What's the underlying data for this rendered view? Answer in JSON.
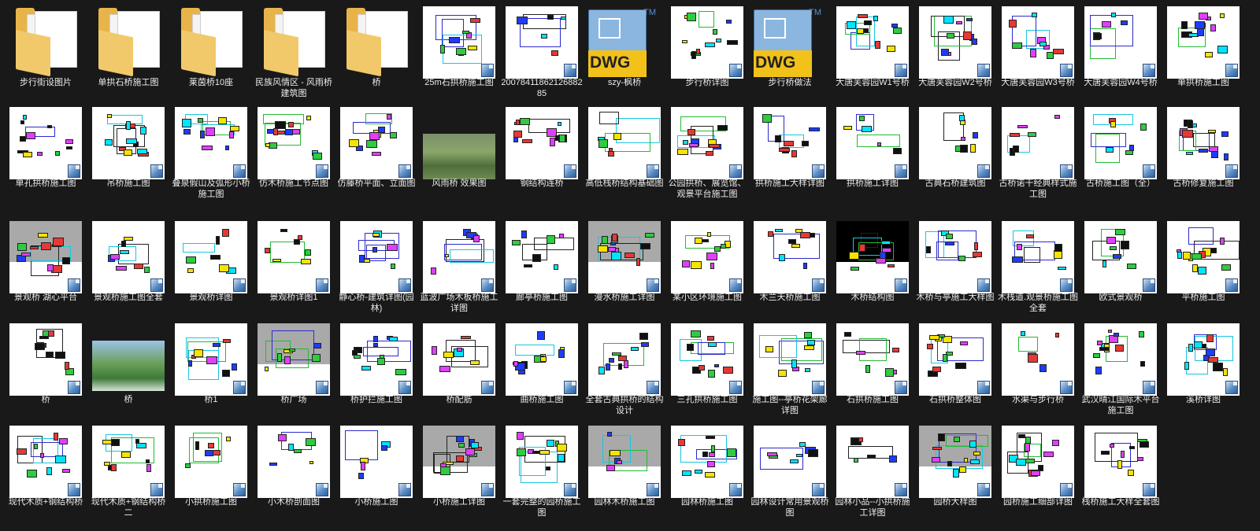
{
  "items": [
    {
      "label": "步行街设图片",
      "kind": "folder"
    },
    {
      "label": "单拱石桥施工图",
      "kind": "folder"
    },
    {
      "label": "莱茵桥10座",
      "kind": "folder"
    },
    {
      "label": "民族风情区 - 风雨桥建筑图",
      "kind": "folder"
    },
    {
      "label": "桥",
      "kind": "folder"
    },
    {
      "label": "25m石拱桥施工图",
      "kind": "cad"
    },
    {
      "label": "2007841186212688285",
      "kind": "cad"
    },
    {
      "label": "szy-枫桥",
      "kind": "dwg"
    },
    {
      "label": "步行桥详图",
      "kind": "cad"
    },
    {
      "label": "步行桥做法",
      "kind": "dwg"
    },
    {
      "label": "大唐芙蓉园W1号桥",
      "kind": "cad"
    },
    {
      "label": "大唐芙蓉园W2号桥",
      "kind": "cad"
    },
    {
      "label": "大唐芙蓉园W3号桥",
      "kind": "cad"
    },
    {
      "label": "大唐芙蓉园W4号桥",
      "kind": "cad"
    },
    {
      "label": "单拱桥施工图",
      "kind": "cad"
    },
    {
      "label": "单孔拱桥施工图",
      "kind": "cad"
    },
    {
      "label": "吊桥施工图",
      "kind": "cad"
    },
    {
      "label": "叠泉假山及弧形小桥施工图",
      "kind": "cad"
    },
    {
      "label": "仿木桥施工节点图",
      "kind": "cad"
    },
    {
      "label": "仿藤桥平面、立面图",
      "kind": "cad"
    },
    {
      "label": "风雨桥 效果图",
      "kind": "photo"
    },
    {
      "label": "钢结构连桥",
      "kind": "cad"
    },
    {
      "label": "高低栈桥结构基础图",
      "kind": "cad"
    },
    {
      "label": "公园拱桥、展览馆、观景平台施工图",
      "kind": "cad"
    },
    {
      "label": "拱桥施工大样详图",
      "kind": "cad"
    },
    {
      "label": "拱桥施工详图",
      "kind": "cad"
    },
    {
      "label": "古典石桥建筑图",
      "kind": "cad"
    },
    {
      "label": "古桥诺干经典样式施工图",
      "kind": "cad"
    },
    {
      "label": "古桥施工图（全）",
      "kind": "cad"
    },
    {
      "label": "古桥修复施工图",
      "kind": "cad"
    },
    {
      "label": "景观桥 湖心平台",
      "kind": "cad"
    },
    {
      "label": "景观桥施工图全套",
      "kind": "cad"
    },
    {
      "label": "景观桥详图",
      "kind": "cad"
    },
    {
      "label": "景观桥详图1",
      "kind": "cad"
    },
    {
      "label": "静心桥-建筑详图(园林)",
      "kind": "cad"
    },
    {
      "label": "蓝波广场木板桥施工详图",
      "kind": "cad"
    },
    {
      "label": "廊亭桥施工图",
      "kind": "cad"
    },
    {
      "label": "漫水桥施工详图",
      "kind": "cad"
    },
    {
      "label": "某小区环境施工图",
      "kind": "cad"
    },
    {
      "label": "木兰天桥施工图",
      "kind": "cad"
    },
    {
      "label": "木桥结构图",
      "kind": "cad"
    },
    {
      "label": "木桥与亭施工大样图",
      "kind": "cad"
    },
    {
      "label": "木栈道.观景桥施工图全套",
      "kind": "cad"
    },
    {
      "label": "欧式景观桥",
      "kind": "cad"
    },
    {
      "label": "平桥施工图",
      "kind": "cad"
    },
    {
      "label": "桥",
      "kind": "cad"
    },
    {
      "label": "桥",
      "kind": "photo"
    },
    {
      "label": "桥1",
      "kind": "cad"
    },
    {
      "label": "桥广场",
      "kind": "cad"
    },
    {
      "label": "桥护拦施工图",
      "kind": "cad"
    },
    {
      "label": "桥配筋",
      "kind": "cad"
    },
    {
      "label": "曲桥施工图",
      "kind": "cad"
    },
    {
      "label": "全套古典拱桥的结构设计",
      "kind": "cad"
    },
    {
      "label": "三孔拱桥施工图",
      "kind": "cad"
    },
    {
      "label": "施工图--亭桥花架廊详图",
      "kind": "cad"
    },
    {
      "label": "石拱桥施工图",
      "kind": "cad"
    },
    {
      "label": "石拱桥整体图",
      "kind": "cad"
    },
    {
      "label": "水渠与步行桥",
      "kind": "cad"
    },
    {
      "label": "武汉晴江国际木平台施工图",
      "kind": "cad"
    },
    {
      "label": "溪桥详图",
      "kind": "cad"
    },
    {
      "label": "现代木质+钢结构桥",
      "kind": "cad"
    },
    {
      "label": "现代木质+钢结构桥二",
      "kind": "cad"
    },
    {
      "label": "小拱桥施工图",
      "kind": "cad"
    },
    {
      "label": "小木桥剖面图",
      "kind": "cad"
    },
    {
      "label": "小桥施工图",
      "kind": "cad"
    },
    {
      "label": "小桥施工详图",
      "kind": "cad"
    },
    {
      "label": "一套完整的园桥施工图",
      "kind": "cad"
    },
    {
      "label": "园林木桥施工图",
      "kind": "cad"
    },
    {
      "label": "园林桥施工图",
      "kind": "cad"
    },
    {
      "label": "园林设计常用景观桥图",
      "kind": "cad"
    },
    {
      "label": "园林小品--小拱桥施工详图",
      "kind": "cad"
    },
    {
      "label": "园桥大样图",
      "kind": "cad"
    },
    {
      "label": "园桥施工细部详图",
      "kind": "cad"
    },
    {
      "label": "栈桥施工大样全套图",
      "kind": "cad"
    }
  ],
  "dwg_text": "DWG",
  "dwg_tm": "TM"
}
